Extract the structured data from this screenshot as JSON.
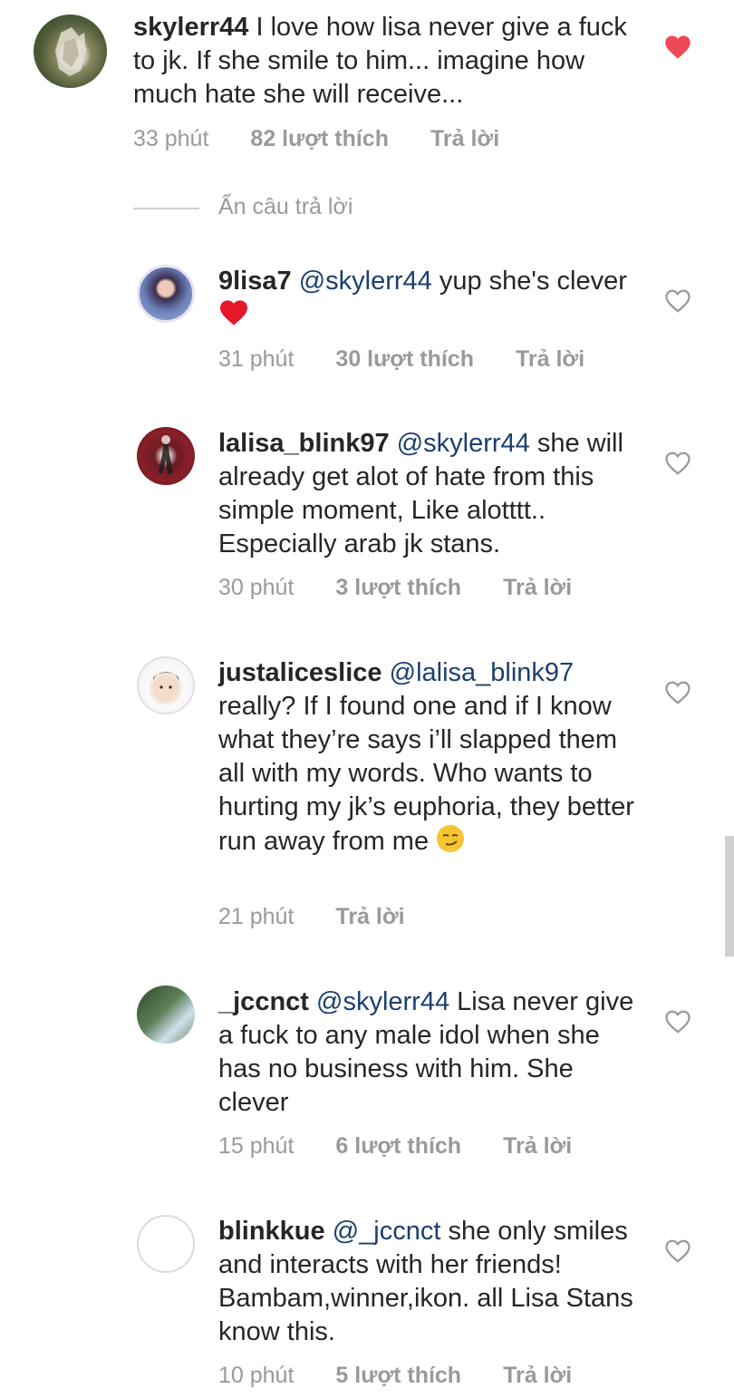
{
  "main_comment": {
    "username": "skylerr44",
    "text": " I love how lisa never give a fuck to jk. If she smile to him... imagine how much hate she will receive...",
    "time": "33 phút",
    "likes": "82 lượt thích",
    "reply_label": "Trả lời",
    "liked": true
  },
  "hide_replies_label": "Ẩn câu trả lời",
  "replies": [
    {
      "username": "9lisa7",
      "mention": "@skylerr44",
      "text": " yup she's clever ",
      "emoji": "red-heart",
      "time": "31 phút",
      "likes": "30 lượt thích",
      "reply_label": "Trả lời"
    },
    {
      "username": "lalisa_blink97",
      "mention": "@skylerr44",
      "text": " she will already get alot of hate from this simple moment, Like alotttt.. Especially arab jk stans.",
      "time": "30 phút",
      "likes": "3 lượt thích",
      "reply_label": "Trả lời"
    },
    {
      "username": "justaliceslice",
      "mention": "@lalisa_blink97",
      "text": " really? If I found one and if I know what they’re says i’ll slapped them all with my words. Who wants to hurting my jk’s euphoria, they better run away from me ",
      "emoji": "smirk-face",
      "time": "21 phút",
      "reply_label": "Trả lời"
    },
    {
      "username": "_jccnct",
      "mention": "@skylerr44",
      "text": " Lisa never give a fuck to any male idol when she has no business with him. She clever",
      "time": "15 phút",
      "likes": "6 lượt thích",
      "reply_label": "Trả lời"
    },
    {
      "username": "blinkkue",
      "mention": "@_jccnct",
      "text": " she only smiles and interacts with her friends! Bambam,winner,ikon. all Lisa Stans know this.",
      "time": "10 phút",
      "likes": "5 lượt thích",
      "reply_label": "Trả lời"
    }
  ],
  "colors": {
    "text": "#262626",
    "meta": "#9a9a9a",
    "mention": "#1c3f6e",
    "liked_heart": "#ed4956"
  }
}
